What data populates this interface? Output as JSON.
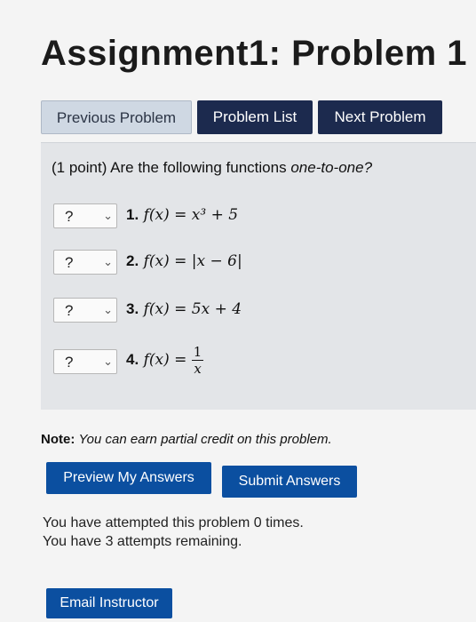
{
  "title": "Assignment1: Problem 1",
  "nav": {
    "previous": "Previous Problem",
    "list": "Problem List",
    "next": "Next Problem"
  },
  "problem": {
    "points": "(1 point) Are the following functions",
    "question_emph": "one-to-one?",
    "items": [
      {
        "num": "1.",
        "select": "?",
        "expr": "f(x) = x³ + 5"
      },
      {
        "num": "2.",
        "select": "?",
        "expr": "f(x) = |x − 6|"
      },
      {
        "num": "3.",
        "select": "?",
        "expr": "f(x) = 5x + 4"
      },
      {
        "num": "4.",
        "select": "?",
        "lhs": "f(x) =",
        "frac_num": "1",
        "frac_den": "x"
      }
    ]
  },
  "note": {
    "label": "Note:",
    "text": "You can earn partial credit on this problem."
  },
  "actions": {
    "preview": "Preview My Answers",
    "submit": "Submit Answers",
    "email": "Email Instructor"
  },
  "status": {
    "line1": "You have attempted this problem 0 times.",
    "line2": "You have 3 attempts remaining."
  }
}
